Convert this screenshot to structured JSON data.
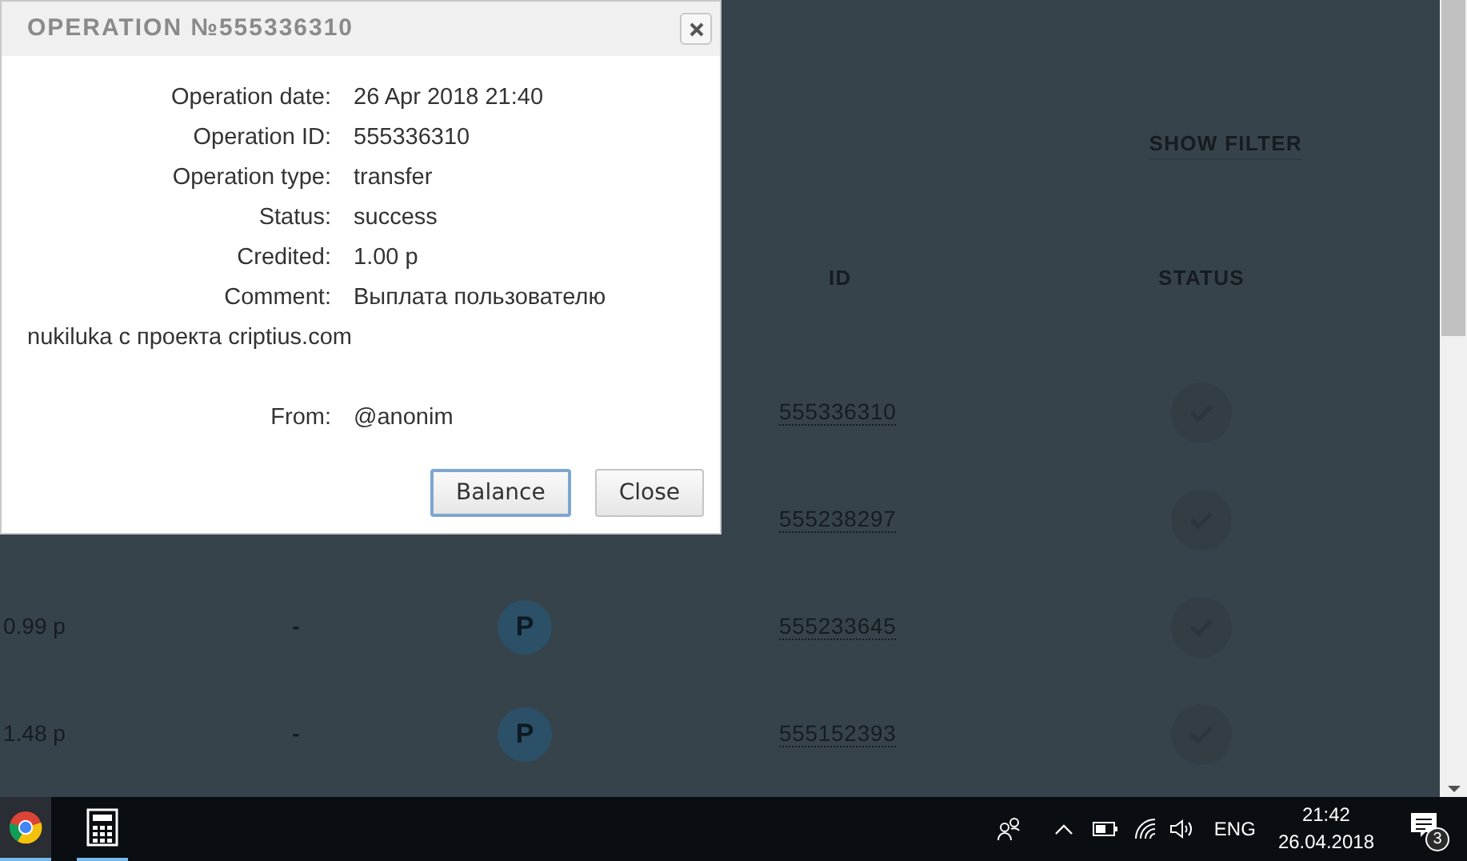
{
  "page": {
    "filter_link": "SHOW FILTER",
    "columns": [
      {
        "label": "ID"
      },
      {
        "label": "STATUS"
      }
    ],
    "rows": [
      {
        "id": "555336310"
      },
      {
        "id": "555238297"
      },
      {
        "amount": "0.99 р",
        "column_2": "-",
        "currency": "P",
        "id": "555233645"
      },
      {
        "amount": "1.48 р",
        "column_2": "-",
        "currency": "P",
        "id": "555152393"
      }
    ]
  },
  "dialog": {
    "title": "OPERATION №555336310",
    "fields": [
      {
        "label": "Operation date:",
        "value": "26 Apr 2018 21:40",
        "separated": false
      },
      {
        "label": "Operation ID:",
        "value": "555336310",
        "separated": false
      },
      {
        "label": "Operation type:",
        "value": "transfer",
        "separated": false
      },
      {
        "label": "Status:",
        "value": "success",
        "separated": false
      },
      {
        "label": "Credited:",
        "value": "1.00 р",
        "separated": false
      },
      {
        "label": "Comment:",
        "value": "Выплата пользователю nukiluka с проекта criptius.com",
        "separated": false,
        "kind": "paragraph"
      },
      {
        "label": "From:",
        "value": "@anonim",
        "separated": true
      }
    ],
    "buttons": [
      {
        "label": "Balance",
        "focused": true
      },
      {
        "label": "Close",
        "focused": false
      }
    ]
  },
  "taskbar": {
    "apps": [
      {
        "kind": "chrome",
        "highlighted": true
      },
      {
        "kind": "calculator",
        "highlighted": false
      }
    ],
    "language": "ENG",
    "time": "21:42",
    "date": "26.04.2018",
    "notification_count": "3"
  }
}
